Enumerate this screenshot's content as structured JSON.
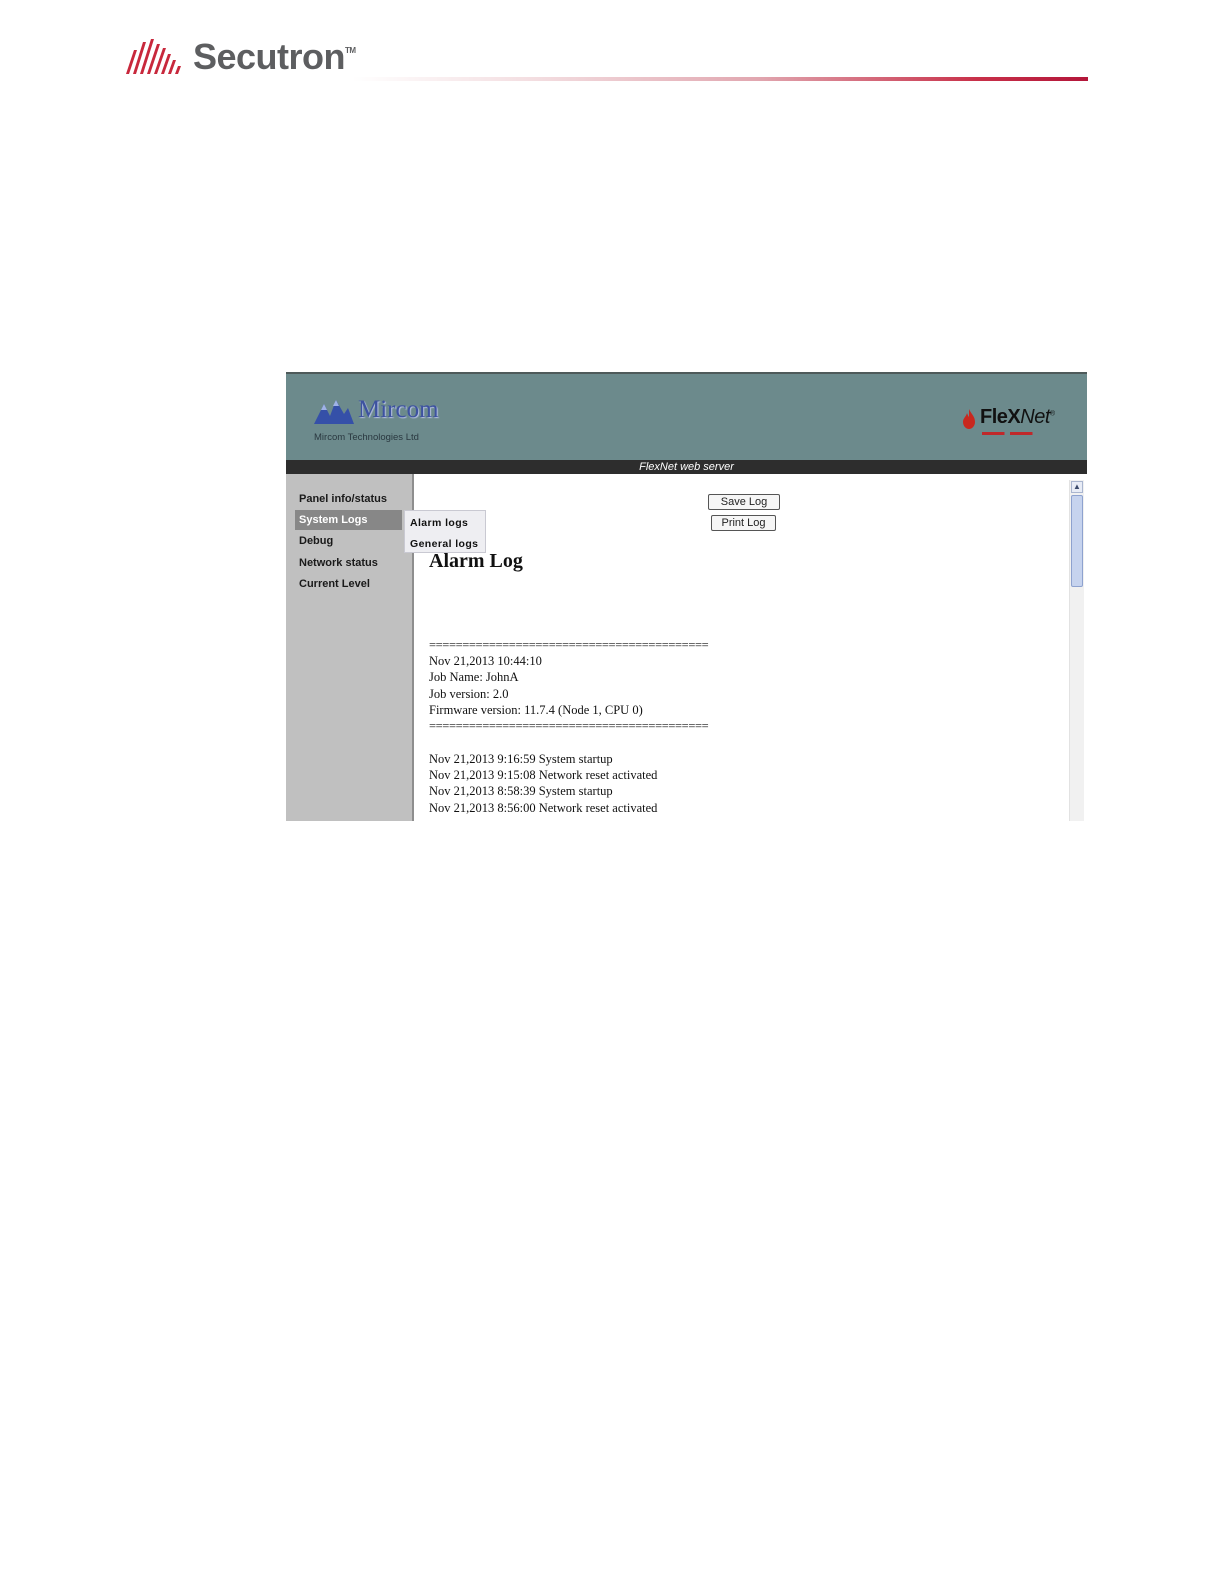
{
  "document_header": {
    "brand_name": "Secutron",
    "brand_tm": "TM"
  },
  "screenshot": {
    "banner": {
      "logo_name": "Mircom",
      "logo_subtitle": "Mircom Technologies Ltd",
      "product_name_bold": "FleX",
      "product_name_italic": "Net",
      "product_tm": "®"
    },
    "server_bar": "FlexNet web server",
    "sidebar": {
      "items": [
        {
          "label": "Panel info/status"
        },
        {
          "label": "System Logs",
          "active": true
        },
        {
          "label": "Debug"
        },
        {
          "label": "Network status"
        },
        {
          "label": "Current Level"
        }
      ],
      "submenu": [
        {
          "label": "Alarm logs"
        },
        {
          "label": "General logs"
        }
      ]
    },
    "buttons": {
      "save": "Save Log",
      "print": "Print Log"
    },
    "log": {
      "title": "Alarm Log",
      "separator": "==========================================",
      "header_lines": [
        "Nov 21,2013 10:44:10",
        "Job Name: JohnA",
        "Job version: 2.0",
        "Firmware version: 11.7.4 (Node 1, CPU 0)"
      ],
      "entries": [
        "Nov 21,2013 9:16:59 System startup",
        "Nov 21,2013 9:15:08 Network reset activated",
        "Nov 21,2013 8:58:39 System startup",
        "Nov 21,2013 8:56:00 Network reset activated"
      ]
    },
    "colors": {
      "banner": "#6c8a8c",
      "sidebar": "#c0c0c0",
      "active_nav": "#878787",
      "brand_red": "#b3163a"
    }
  }
}
